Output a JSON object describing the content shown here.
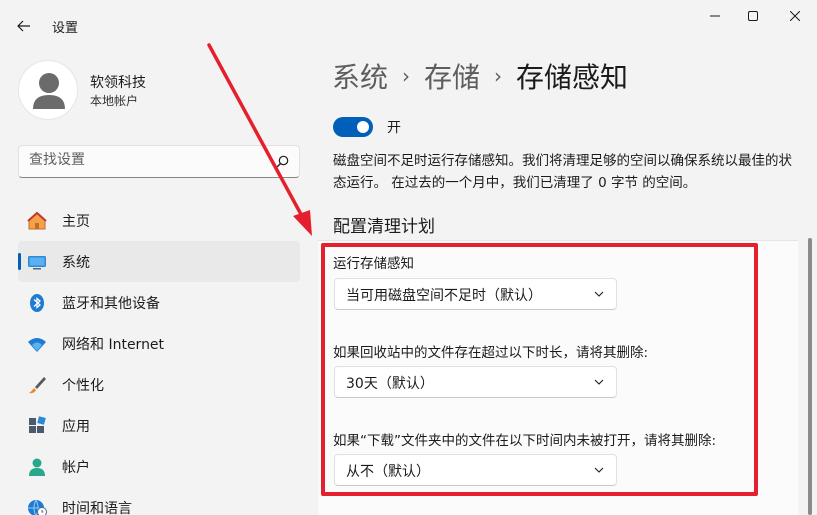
{
  "window": {
    "title": "设置",
    "controls": {
      "minimize": "minimize-icon",
      "maximize": "maximize-icon",
      "close": "close-icon"
    }
  },
  "profile": {
    "name": "软领科技",
    "account_type": "本地帐户"
  },
  "search": {
    "placeholder": "查找设置"
  },
  "sidebar": {
    "items": [
      {
        "label": "主页",
        "icon": "home-icon",
        "active": false
      },
      {
        "label": "系统",
        "icon": "system-icon",
        "active": true
      },
      {
        "label": "蓝牙和其他设备",
        "icon": "bluetooth-icon",
        "active": false
      },
      {
        "label": "网络和 Internet",
        "icon": "wifi-icon",
        "active": false
      },
      {
        "label": "个性化",
        "icon": "brush-icon",
        "active": false
      },
      {
        "label": "应用",
        "icon": "apps-icon",
        "active": false
      },
      {
        "label": "帐户",
        "icon": "account-icon",
        "active": false
      },
      {
        "label": "时间和语言",
        "icon": "globe-clock-icon",
        "active": false
      }
    ]
  },
  "breadcrumb": {
    "parent1": "系统",
    "parent2": "存储",
    "current": "存储感知",
    "separator": "›"
  },
  "storage_sense": {
    "toggle_state": "开",
    "description": "磁盘空间不足时运行存储感知。我们将清理足够的空间以确保系统以最佳的状态运行。 在过去的一个月中，我们已清理了 0 字节 的空间。",
    "section_heading": "配置清理计划",
    "fields": [
      {
        "label": "运行存储感知",
        "value": "当可用磁盘空间不足时（默认）"
      },
      {
        "label": "如果回收站中的文件存在超过以下时长，请将其删除:",
        "value": "30天（默认）"
      },
      {
        "label": "如果“下载”文件夹中的文件在以下时间内未被打开，请将其删除:",
        "value": "从不（默认）"
      }
    ]
  },
  "colors": {
    "accent": "#005fb8",
    "annotation_red": "#e5202e",
    "background": "#f3f3f3",
    "card": "#fbfbfb"
  }
}
